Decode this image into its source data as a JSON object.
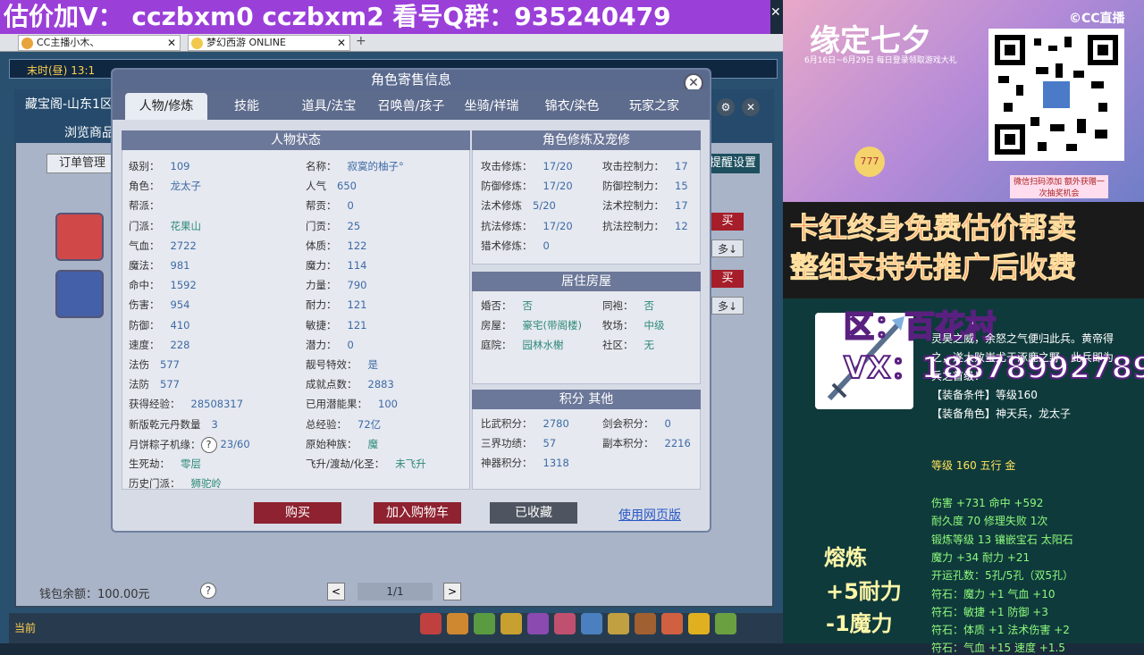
{
  "banner": {
    "text": "估价加V：  cczbxm0   cczbxm2   看号Q群：935240479"
  },
  "browser": {
    "tabs": [
      {
        "label": "CC主播小木、"
      },
      {
        "label": "梦幻西游 ONLINE"
      }
    ]
  },
  "game": {
    "time_label": "末时(昼)",
    "time_value": "13:1",
    "bottom_label": "当前",
    "bg_window": {
      "title": "藏宝阁-山东1区",
      "browse_label": "浏览商品",
      "order_button": "订单管理",
      "settings_button": "提醒设置",
      "buy_label": "买",
      "more_label": "多↓",
      "wallet": "钱包余额：100.00元",
      "help": "?",
      "pagination": {
        "prev": "<",
        "page": "1/1",
        "next": ">"
      }
    }
  },
  "dialog": {
    "title": "角色寄售信息",
    "close": "✕",
    "tabs": [
      "人物/修炼",
      "技能",
      "道具/法宝",
      "召唤兽/孩子",
      "坐骑/祥瑞",
      "锦衣/染色",
      "玩家之家"
    ],
    "status_header": "人物状态",
    "status_left": [
      {
        "label": "级别：",
        "value": "109"
      },
      {
        "label": "角色：",
        "value": "龙太子"
      },
      {
        "label": "帮派：",
        "value": ""
      },
      {
        "label": "门派：",
        "value": "花果山"
      },
      {
        "label": "气血：",
        "value": "2722"
      },
      {
        "label": "魔法：",
        "value": "981"
      },
      {
        "label": "命中：",
        "value": "1592"
      },
      {
        "label": "伤害：",
        "value": "954"
      },
      {
        "label": "防御：",
        "value": "410"
      },
      {
        "label": "速度：",
        "value": "228"
      },
      {
        "label": "法伤",
        "value": "577"
      },
      {
        "label": "法防",
        "value": "577"
      },
      {
        "label": "获得经验：",
        "value": "28508317"
      },
      {
        "label": "新版乾元丹数量",
        "value": "3"
      },
      {
        "label": "月饼粽子机缘：",
        "value": "23/60"
      },
      {
        "label": "生死劫：",
        "value": "零层"
      },
      {
        "label": "历史门派：",
        "value": "狮驼岭"
      }
    ],
    "status_right": [
      {
        "label": "名称：",
        "value": "寂寞的柚子°"
      },
      {
        "label": "人气",
        "value": "650"
      },
      {
        "label": "帮贡：",
        "value": "0"
      },
      {
        "label": "门贡：",
        "value": "25"
      },
      {
        "label": "体质：",
        "value": "122"
      },
      {
        "label": "魔力：",
        "value": "114"
      },
      {
        "label": "力量：",
        "value": "790"
      },
      {
        "label": "耐力：",
        "value": "121"
      },
      {
        "label": "敏捷：",
        "value": "121"
      },
      {
        "label": "潜力：",
        "value": "0"
      },
      {
        "label": "靓号特效：",
        "value": "是"
      },
      {
        "label": "成就点数：",
        "value": "2883"
      },
      {
        "label": "已用潜能果：",
        "value": "100"
      },
      {
        "label": "总经验：",
        "value": "72亿"
      },
      {
        "label": "原始种族：",
        "value": "魔"
      },
      {
        "label": "飞升/渡劫/化圣：",
        "value": "未飞升"
      }
    ],
    "cultivation_header": "角色修炼及宠修",
    "cultivation_left": [
      {
        "label": "攻击修炼：",
        "value": "17/20"
      },
      {
        "label": "防御修炼：",
        "value": "17/20"
      },
      {
        "label": "法术修炼",
        "value": "5/20"
      },
      {
        "label": "抗法修炼：",
        "value": "17/20"
      },
      {
        "label": "猎术修炼：",
        "value": "0"
      }
    ],
    "cultivation_right": [
      {
        "label": "攻击控制力：",
        "value": "17"
      },
      {
        "label": "防御控制力：",
        "value": "15"
      },
      {
        "label": "法术控制力：",
        "value": "17"
      },
      {
        "label": "抗法控制力：",
        "value": "12"
      }
    ],
    "house_header": "居住房屋",
    "house": [
      {
        "label": "婚否：",
        "value": "否"
      },
      {
        "label": "同袍：",
        "value": "否"
      },
      {
        "label": "房屋：",
        "value": "豪宅(带阁楼)"
      },
      {
        "label": "牧场：",
        "value": "中级"
      },
      {
        "label": "庭院：",
        "value": "园林水榭"
      },
      {
        "label": "社区：",
        "value": "无"
      }
    ],
    "score_header": "积分 其他",
    "score": [
      {
        "label": "比武积分：",
        "value": "2780"
      },
      {
        "label": "剑会积分：",
        "value": "0"
      },
      {
        "label": "三界功绩：",
        "value": "57"
      },
      {
        "label": "副本积分：",
        "value": "2216"
      },
      {
        "label": "神器积分：",
        "value": "1318"
      }
    ],
    "help_icon": "?",
    "buttons": {
      "buy": "购买",
      "cart": "加入购物车",
      "fav": "已收藏",
      "web": "使用网页版"
    }
  },
  "stream": {
    "ad_title": "缘定七夕",
    "ad_sub": "6月16日~6月29日 每日登录领取游戏大礼",
    "cc_logo": "©CC直播",
    "ad_badge": "777",
    "ad_fine": "微信扫码添加 额外获赠一次抽奖机会",
    "red_line1": "卡红终身免费估价帮卖",
    "red_line2": "整组支持先推广后收费",
    "zone": "区：百花村",
    "vx": "VX：18878992789",
    "item_lines": [
      "灵昊之威，余怒之气便归此兵。黄帝得",
      "之，遂大败蚩尤于涿鹿之野，此兵即为",
      "兵之首级！",
      "【装备条件】等级160",
      "【装备角色】神天兵，龙太子",
      "等级 160 五行 金",
      "伤害 +731 命中 +592",
      "耐久度 70  修理失败 1次",
      "锻炼等级 13  镶嵌宝石 太阳石",
      "魔力 +34 耐力 +21",
      "开运孔数：5孔/5孔（双5孔）",
      "符石：魔力 +1 气血 +10",
      "符石：敏捷 +1 防御 +3",
      "符石：体质 +1 法术伤害 +2",
      "符石：气血 +15 速度 +1.5"
    ],
    "smelt_title": "熔炼",
    "smelt1": "+5耐力",
    "smelt2": "-1魔力"
  },
  "colors": {
    "banner": "#9b3fd9",
    "buy": "#8e2230",
    "fav": "#4f5560",
    "panel_head": "#6c7899"
  }
}
